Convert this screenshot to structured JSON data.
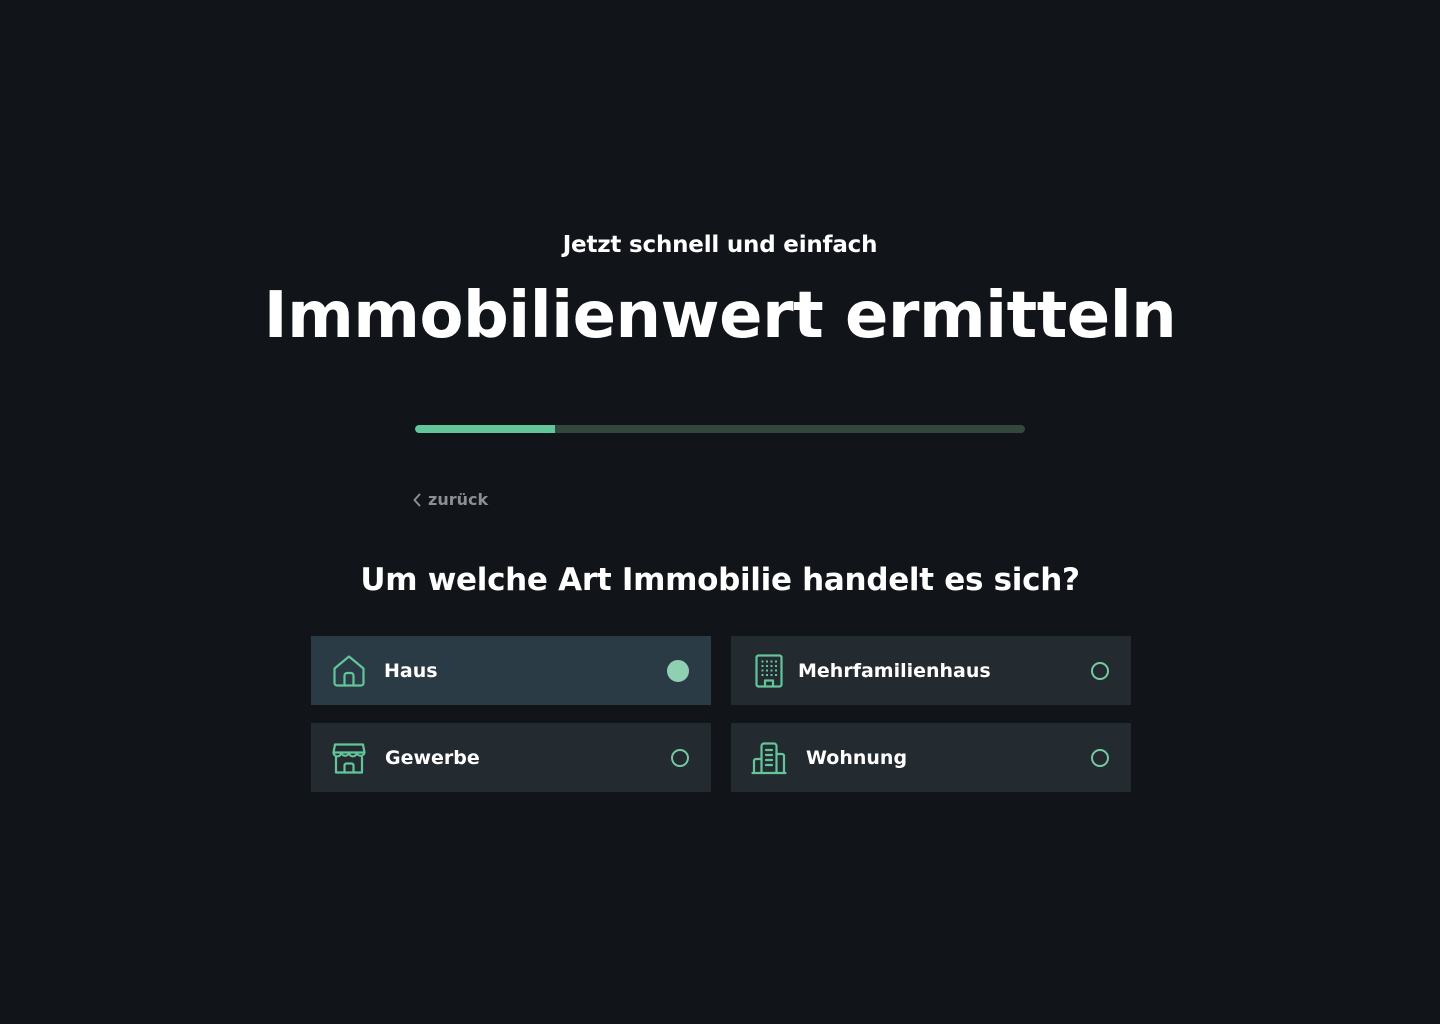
{
  "header": {
    "eyebrow": "Jetzt schnell und einfach",
    "title": "Immobilienwert ermitteln"
  },
  "progress": {
    "fraction": 0.23,
    "fill_color": "#62c69a",
    "track_color": "#33473f"
  },
  "navigation": {
    "back_label": "zurück",
    "back_icon": "chevron-left-icon"
  },
  "question": {
    "text": "Um welche Art Immobilie handelt es sich?"
  },
  "options": [
    {
      "label": "Haus",
      "icon": "house-icon",
      "selected": true
    },
    {
      "label": "Mehrfamilienhaus",
      "icon": "apartment-building-icon",
      "selected": false
    },
    {
      "label": "Gewerbe",
      "icon": "storefront-icon",
      "selected": false
    },
    {
      "label": "Wohnung",
      "icon": "flat-building-icon",
      "selected": false
    }
  ],
  "colors": {
    "background": "#111418",
    "option_background": "#232a30",
    "option_selected_background": "#2a3b45",
    "accent": "#77c9a4"
  }
}
